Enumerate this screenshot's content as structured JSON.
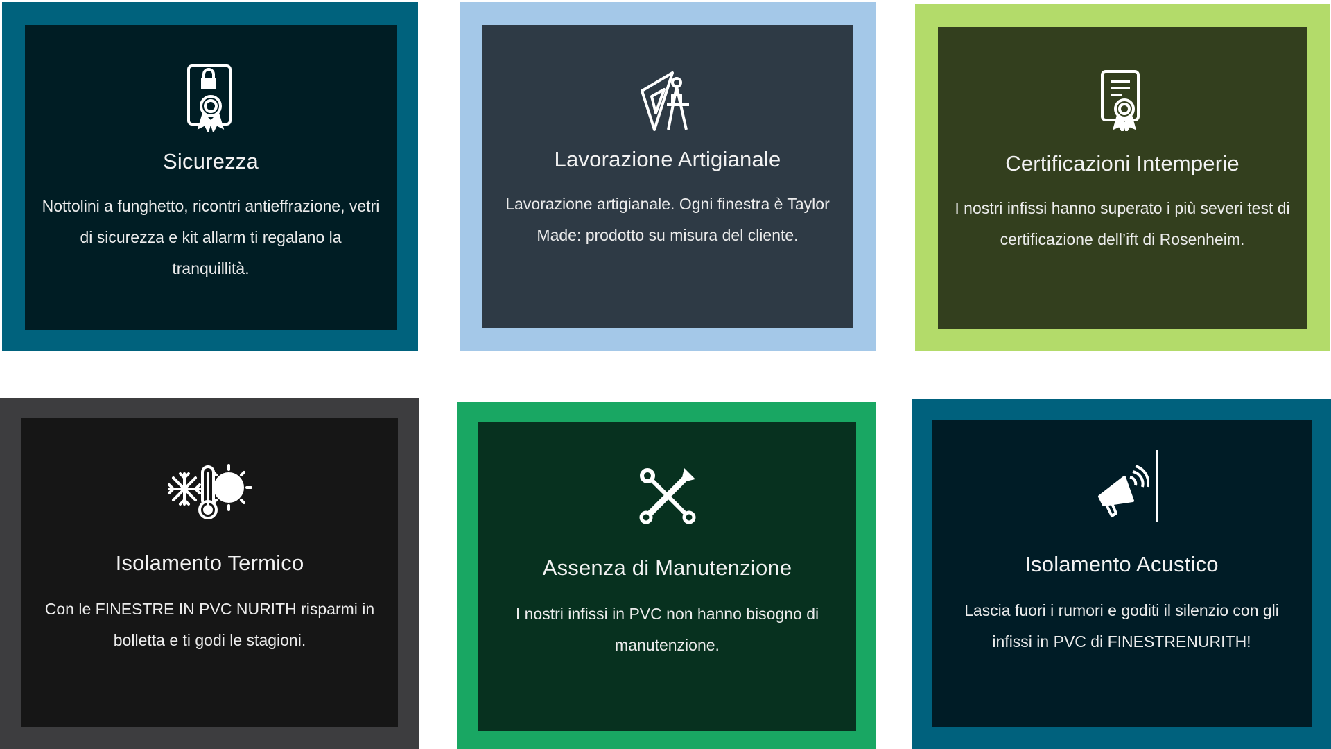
{
  "colors": {
    "frame_1": "#00627d",
    "inner_1": "#001d24",
    "frame_2": "#a4c8e8",
    "inner_2": "#2e3a45",
    "frame_3": "#b3db6a",
    "inner_3": "#333f1e",
    "frame_4": "#3d3d3f",
    "inner_4": "#161616",
    "frame_5": "#19a763",
    "inner_5": "#07311f",
    "frame_6": "#00617d",
    "inner_6": "#001c26"
  },
  "cards": [
    {
      "icon": "lock-certificate-icon",
      "title": "Sicurezza",
      "text": "Nottolini a funghetto, ricontri antieffrazione, vetri di sicurezza e kit allarm ti regalano la tranquillità."
    },
    {
      "icon": "drafting-tools-icon",
      "title": "Lavorazione Artigianale",
      "text": "Lavorazione artigianale. Ogni finestra è Taylor Made: prodotto su misura del cliente."
    },
    {
      "icon": "certificate-document-icon",
      "title": "Certificazioni Intemperie",
      "text": "I nostri infissi hanno superato i più severi test di certificazione dell’ift di Rosenheim."
    },
    {
      "icon": "thermometer-snow-sun-icon",
      "title": "Isolamento Termico",
      "text": "Con le FINESTRE IN PVC NURITH risparmi in bolletta e ti godi le stagioni."
    },
    {
      "icon": "wrench-screwdriver-icon",
      "title": "Assenza di Manutenzione",
      "text": "I nostri infissi in PVC non hanno bisogno di manutenzione."
    },
    {
      "icon": "megaphone-icon",
      "title": "Isolamento Acustico",
      "text": "Lascia fuori i rumori e goditi il silenzio con gli infissi in PVC di FINESTRENURITH!"
    }
  ]
}
